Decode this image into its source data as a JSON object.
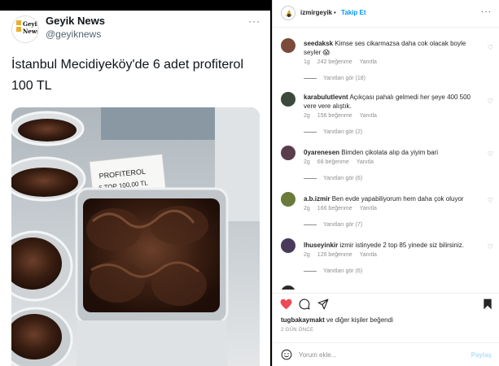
{
  "tweet": {
    "name": "Geyik News",
    "handle": "@geyiknews",
    "more": "···",
    "text": "İstanbul Mecidiyeköy'de 6 adet profiterol 100 TL",
    "logo_line1": "Geyik",
    "logo_line2": "News",
    "media": {
      "label_line1": "PROFITEROL",
      "label_line2": "6 TOP 100,00 TL"
    }
  },
  "instagram": {
    "username": "izmirgeyik",
    "dot": "•",
    "follow_label": "Takip Et",
    "more": "···",
    "comments": [
      {
        "user": "seedaksk",
        "text": "Kimse ses cikarmazsa daha cok olacak boyle seyler 😱",
        "time": "1g",
        "likes": "242 beğenme",
        "reply": "Yanıtla",
        "view_replies": "Yanıtları gör (18)",
        "avatar_color": "#7a4a3a"
      },
      {
        "user": "karabulutlevnt",
        "text": "Açıkçası pahalı gelmedi her şeye 400 500 vere vere alıştık.",
        "time": "2g",
        "likes": "156 beğenme",
        "reply": "Yanıtla",
        "view_replies": "Yanıtları gör (2)",
        "avatar_color": "#3c4a3e"
      },
      {
        "user": "0yarenesen",
        "text": "Bimden çikolata alıp da yiyim bari",
        "time": "2g",
        "likes": "68 beğenme",
        "reply": "Yanıtla",
        "view_replies": "Yanıtları gör (6)",
        "avatar_color": "#5a3d4a"
      },
      {
        "user": "a.b.izmir",
        "text": "Ben evde yapabiliyorum hem daha çok oluyor",
        "time": "2g",
        "likes": "166 beğenme",
        "reply": "Yanıtla",
        "view_replies": "Yanıtları gör (7)",
        "avatar_color": "#6a7a3a"
      },
      {
        "user": "lhuseyinkir",
        "text": "izmir istinyede 2 top 85 yinede siz bilirsiniz.",
        "time": "2g",
        "likes": "126 beğenme",
        "reply": "Yanıtla",
        "view_replies": "Yanıtları gör (6)",
        "avatar_color": "#4a3a5a"
      },
      {
        "user": "",
        "text": "",
        "avatar_color": "#2a2a2a"
      }
    ],
    "likes_user": "tugbakaymakt",
    "likes_rest": "ve diğer kişiler beğendi",
    "date": "2 GÜN ÖNCE",
    "comment_placeholder": "Yorum ekle...",
    "post_label": "Paylaş",
    "colors": {
      "heart": "#ed4956",
      "link": "#0095f6"
    },
    "icons": [
      "heart-icon",
      "comment-icon",
      "share-icon",
      "bookmark-icon",
      "emoji-icon"
    ]
  }
}
